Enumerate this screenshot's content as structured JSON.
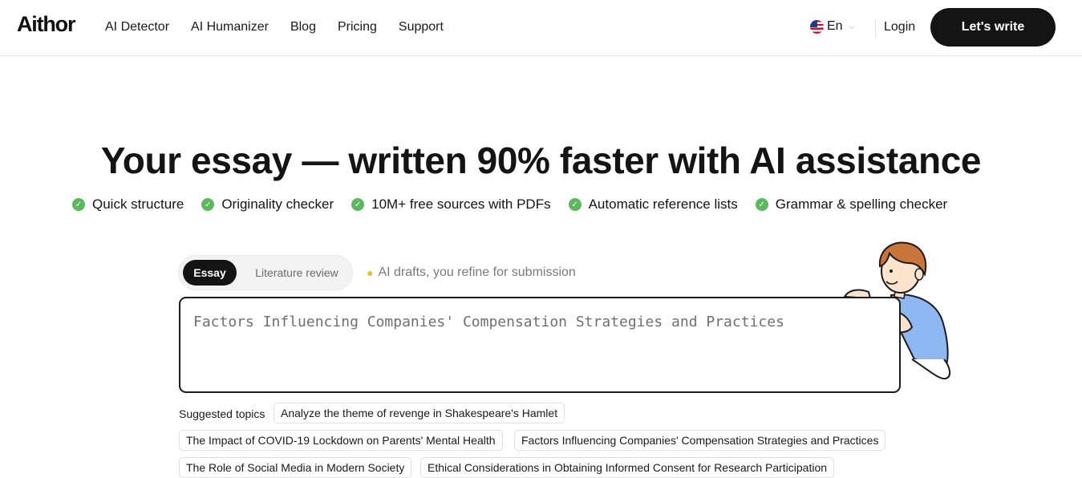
{
  "header": {
    "logo": "Aithor",
    "nav": [
      "AI Detector",
      "AI Humanizer",
      "Blog",
      "Pricing",
      "Support"
    ],
    "language": "En",
    "login": "Login",
    "cta": "Let's write"
  },
  "hero": {
    "title": "Your essay — written 90% faster with AI assistance",
    "features": [
      "Quick structure",
      "Originality checker",
      "10M+ free sources with PDFs",
      "Automatic reference lists",
      "Grammar & spelling checker"
    ]
  },
  "editor": {
    "modes": [
      "Essay",
      "Literature review"
    ],
    "active_mode": "Essay",
    "hint": "AI drafts, you refine for submission",
    "topic_value": "Factors Influencing Companies' Compensation Strategies and Practices"
  },
  "suggestions": {
    "label": "Suggested topics",
    "topics": [
      "Analyze the theme of revenge in Shakespeare's Hamlet",
      "The Impact of COVID-19 Lockdown on Parents' Mental Health",
      "Factors Influencing Companies' Compensation Strategies and Practices",
      "The Role of Social Media in Modern Society",
      "Ethical Considerations in Obtaining Informed Consent for Research Participation"
    ]
  },
  "colors": {
    "accent_dark": "#141414",
    "check_green": "#5cb85c",
    "character_shirt": "#8db8f2",
    "character_hair": "#c8743a"
  }
}
